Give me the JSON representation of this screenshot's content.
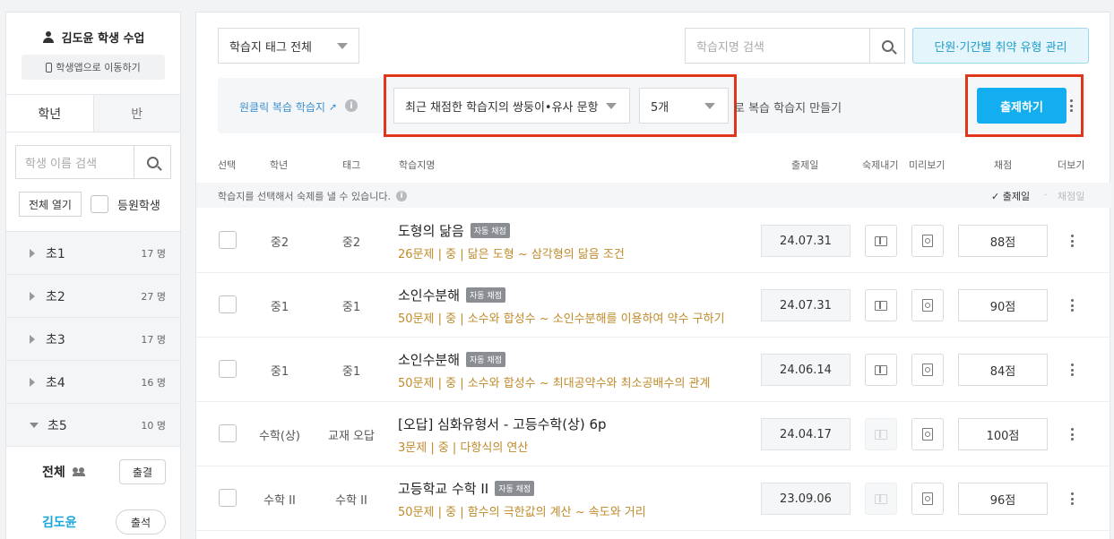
{
  "sidebar": {
    "profile_name": "김도윤 학생 수업",
    "move_app": "학생앱으로 이동하기",
    "tabs": [
      "학년",
      "반"
    ],
    "search_placeholder": "학생 이름 검색",
    "open_all": "전체 열기",
    "enrolled_label": "등원학생",
    "grades": [
      {
        "name": "초1",
        "count": "17 명",
        "expanded": false
      },
      {
        "name": "초2",
        "count": "27 명",
        "expanded": false
      },
      {
        "name": "초3",
        "count": "17 명",
        "expanded": false
      },
      {
        "name": "초4",
        "count": "16 명",
        "expanded": false
      },
      {
        "name": "초5",
        "count": "10 명",
        "expanded": true
      }
    ],
    "all_label": "전체",
    "attendance_all": "출결",
    "student_name": "김도윤",
    "attendance": "출석"
  },
  "toolbar": {
    "tag_filter": "학습지 태그 전체",
    "ws_search_placeholder": "학습지명 검색",
    "weak_manage": "단원·기간별 취약 유형 관리"
  },
  "quickbar": {
    "label": "원클릭 복습 학습지",
    "info": "i",
    "type_select": "최근 채점한 학습지의 쌍둥이•유사 문항",
    "count_select": "5개",
    "suffix_text": "로 복습 학습지 만들기",
    "assign_button": "출제하기"
  },
  "table": {
    "headers": {
      "select": "선택",
      "grade": "학년",
      "tag": "태그",
      "name": "학습지명",
      "date": "출제일",
      "homework": "숙제내기",
      "preview": "미리보기",
      "score": "채점",
      "more": "더보기"
    },
    "notice": "학습지를 선택해서 숙제를 낼 수 있습니다.",
    "sort_date": "✓ 출제일",
    "sort_dot": "·",
    "sort_graded": "채점일",
    "auto_badge": "자동 채점",
    "rows": [
      {
        "grade": "중2",
        "tag": "중2",
        "title": "도형의 닮음",
        "auto": true,
        "desc": "26문제 | 중 | 닮은 도형 ~ 삼각형의 닮음 조건",
        "date": "24.07.31",
        "homework_enabled": true,
        "score": "88점"
      },
      {
        "grade": "중1",
        "tag": "중1",
        "title": "소인수분해",
        "auto": true,
        "desc": "50문제 | 중 | 소수와 합성수 ~ 소인수분해를 이용하여 약수 구하기",
        "date": "24.07.31",
        "homework_enabled": true,
        "score": "90점"
      },
      {
        "grade": "중1",
        "tag": "중1",
        "title": "소인수분해",
        "auto": true,
        "desc": "50문제 | 중 | 소수와 합성수 ~ 최대공약수와 최소공배수의 관계",
        "date": "24.06.14",
        "homework_enabled": true,
        "score": "84점"
      },
      {
        "grade": "수학(상)",
        "tag": "교재 오답",
        "title": "[오답] 심화유형서 - 고등수학(상) 6p",
        "auto": false,
        "desc": "3문제 | 중 | 다항식의 연산",
        "date": "24.04.17",
        "homework_enabled": false,
        "score": "100점"
      },
      {
        "grade": "수학 II",
        "tag": "수학 II",
        "title": "고등학교 수학 II",
        "auto": true,
        "desc": "50문제 | 중 | 함수의 극한값의 계산 ~ 속도와 거리",
        "date": "23.09.06",
        "homework_enabled": false,
        "score": "96점"
      }
    ]
  },
  "colors": {
    "accent": "#13aef0",
    "highlight": "#e0361b",
    "desc": "#c08a2a",
    "student": "#18a6dd"
  }
}
